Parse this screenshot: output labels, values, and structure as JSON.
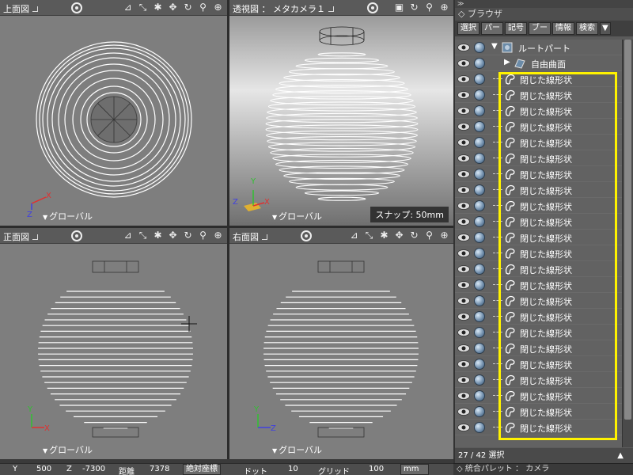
{
  "viewports": {
    "top": {
      "title": "上面図",
      "footer": "グローバル",
      "axes": {
        "x": "X",
        "z": "Z"
      }
    },
    "perspective": {
      "title": "透視図 ： メタカメラ１",
      "footer": "グローバル",
      "snap": "スナップ: 50mm",
      "axes": {
        "y": "Y",
        "x": "X",
        "z": "Z"
      }
    },
    "front": {
      "title": "正面図",
      "footer": "グローバル",
      "axes": {
        "y": "Y",
        "x": "X"
      }
    },
    "right": {
      "title": "右面図",
      "footer": "グローバル",
      "axes": {
        "y": "Y",
        "z": "Z"
      }
    }
  },
  "browser": {
    "title": "ブラウザ",
    "tabs": [
      "選択",
      "パー",
      "記号",
      "ブー",
      "情報",
      "検索"
    ],
    "root_label": "ルートパート",
    "free_surface_label": "自由曲面",
    "items": [
      "閉じた線形状",
      "閉じた線形状",
      "閉じた線形状",
      "閉じた線形状",
      "閉じた線形状",
      "閉じた線形状",
      "閉じた線形状",
      "閉じた線形状",
      "閉じた線形状",
      "閉じた線形状",
      "閉じた線形状",
      "閉じた線形状",
      "閉じた線形状",
      "閉じた線形状",
      "閉じた線形状",
      "閉じた線形状",
      "閉じた線形状",
      "閉じた線形状",
      "閉じた線形状",
      "閉じた線形状",
      "閉じた線形状",
      "閉じた線形状",
      "閉じた線形状"
    ],
    "selection_count": "27 / 42 選択"
  },
  "integrated_palette": "統合パレット ： カメラ",
  "status": {
    "y_label": "Y",
    "y_value": "500",
    "z_label": "Z",
    "z_value": "-7300",
    "distance_label": "距離",
    "distance_value": "7378",
    "coord_mode": "絶対座標",
    "dot_label": "ドット",
    "dot_value": "10",
    "grid_label": "グリッド",
    "grid_value": "100",
    "unit": "mm"
  },
  "colors": {
    "selection_highlight": "#fff200",
    "viewport_bg": "#7e7e7e",
    "axis_x": "#e03030",
    "axis_y": "#30c030",
    "axis_z": "#4040e0"
  }
}
